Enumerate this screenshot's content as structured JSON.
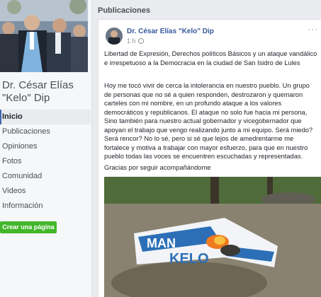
{
  "page": {
    "name": "Dr. César Elías \"Kelo\" Dip",
    "nav": [
      {
        "label": "Inicio",
        "active": true
      },
      {
        "label": "Publicaciones",
        "active": false
      },
      {
        "label": "Opiniones",
        "active": false
      },
      {
        "label": "Fotos",
        "active": false
      },
      {
        "label": "Comunidad",
        "active": false
      },
      {
        "label": "Videos",
        "active": false
      },
      {
        "label": "Información",
        "active": false
      }
    ],
    "create_page_label": "Crear una página"
  },
  "main": {
    "section_title": "Publicaciones",
    "post": {
      "author": "Dr. César Elías \"Kelo\" Dip",
      "time": "1 h ·",
      "more_icon": "more-options-icon",
      "paragraph1": "Libertad de Expresión, Derechos políticos Básicos y un ataque vandálico e irrespetuoso a la Democracia en la ciudad de San Isidro de Lules",
      "paragraph2": "Hoy me tocó vivir de cerca la intolerancia en nuestro pueblo. Un grupo de personas que no sé a quien responden, destrozaron y quemaron carteles con mi nombre, en un profundo ataque a los valores democráticos y republicanos. El ataque no solo fue hacia mi persona, Sino también para nuestro actual gobernador y vicegobernador que apoyan el trabajo que vengo realizando junto a mi equipo. Será miedo? Será rencor? No lo sé, pero si sé que lejos de amedrentarme me fortalece y motiva a trabajar con mayor esfuerzo, para que en nuestro pueblo todas las voces se encuentren escuchadas y representadas.",
      "paragraph3": "Gracias por seguir acompañándome",
      "photo_banner_text_1": "MAN",
      "photo_banner_text_2": "KELO"
    }
  },
  "colors": {
    "link": "#365899",
    "create_button": "#42b72a",
    "background": "#e9ebee"
  }
}
